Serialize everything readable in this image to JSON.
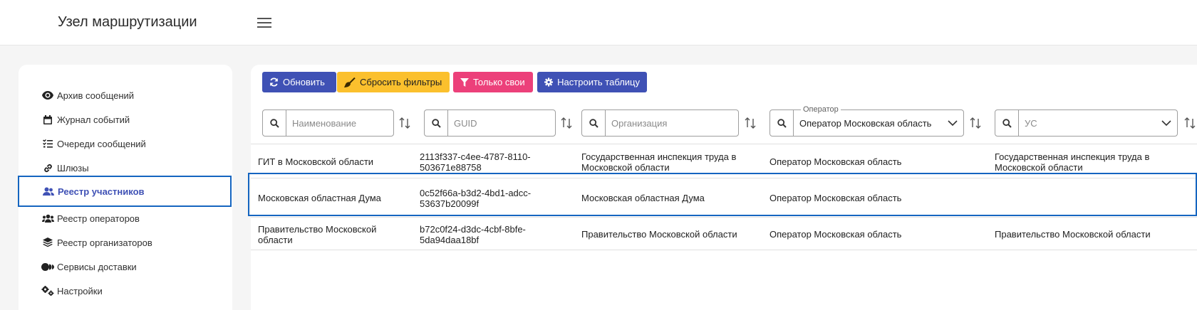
{
  "header": {
    "title": "Узел маршрутизации",
    "menu_icon": "hamburger-icon"
  },
  "sidebar": {
    "items": [
      {
        "label": "Архив сообщений",
        "icon": "eye-icon"
      },
      {
        "label": "Журнал событий",
        "icon": "calendar-icon"
      },
      {
        "label": "Очереди сообщений",
        "icon": "checklist-icon"
      },
      {
        "label": "Шлюзы",
        "icon": "link-icon"
      },
      {
        "label": "Реестр участников",
        "icon": "users-icon",
        "active": true
      },
      {
        "label": "Реестр операторов",
        "icon": "user-group-icon"
      },
      {
        "label": "Реестр организаторов",
        "icon": "layers-icon"
      },
      {
        "label": "Сервисы доставки",
        "icon": "video-icon"
      },
      {
        "label": "Настройки",
        "icon": "gears-icon"
      }
    ],
    "active_color": "#3f51b5",
    "highlight_color": "#1565c0"
  },
  "toolbar": {
    "refresh_label": "Обновить",
    "reset_filters_label": "Сбросить фильтры",
    "only_own_label": "Только свои",
    "configure_table_label": "Настроить таблицу",
    "colors": {
      "primary": "#3f51b5",
      "warning": "#fbc02d",
      "pink": "#ec407a"
    }
  },
  "filters": {
    "name_placeholder": "Наименование",
    "guid_placeholder": "GUID",
    "organization_placeholder": "Организация",
    "operator_legend": "Оператор",
    "operator_value": "Оператор Московская область",
    "us_placeholder": "УС"
  },
  "table": {
    "rows": [
      {
        "name": "ГИТ в Московской области",
        "guid": "2113f337-c4ee-4787-8110-503671e88758",
        "organization": "Государственная инспекция труда в Московской области",
        "operator": "Оператор Московская область",
        "us": "Государственная инспекция труда в Московской области"
      },
      {
        "name": "Московская областная Дума",
        "guid": "0c52f66a-b3d2-4bd1-adcc-53637b20099f",
        "organization": "Московская областная Дума",
        "operator": "Оператор Московская область",
        "us": "",
        "highlighted": true
      },
      {
        "name": "Правительство Московской области",
        "guid": "b72c0f24-d3dc-4cbf-8bfe-5da94daa18bf",
        "organization": "Правительство Московской области",
        "operator": "Оператор Московская область",
        "us": "Правительство Московской области"
      }
    ]
  }
}
